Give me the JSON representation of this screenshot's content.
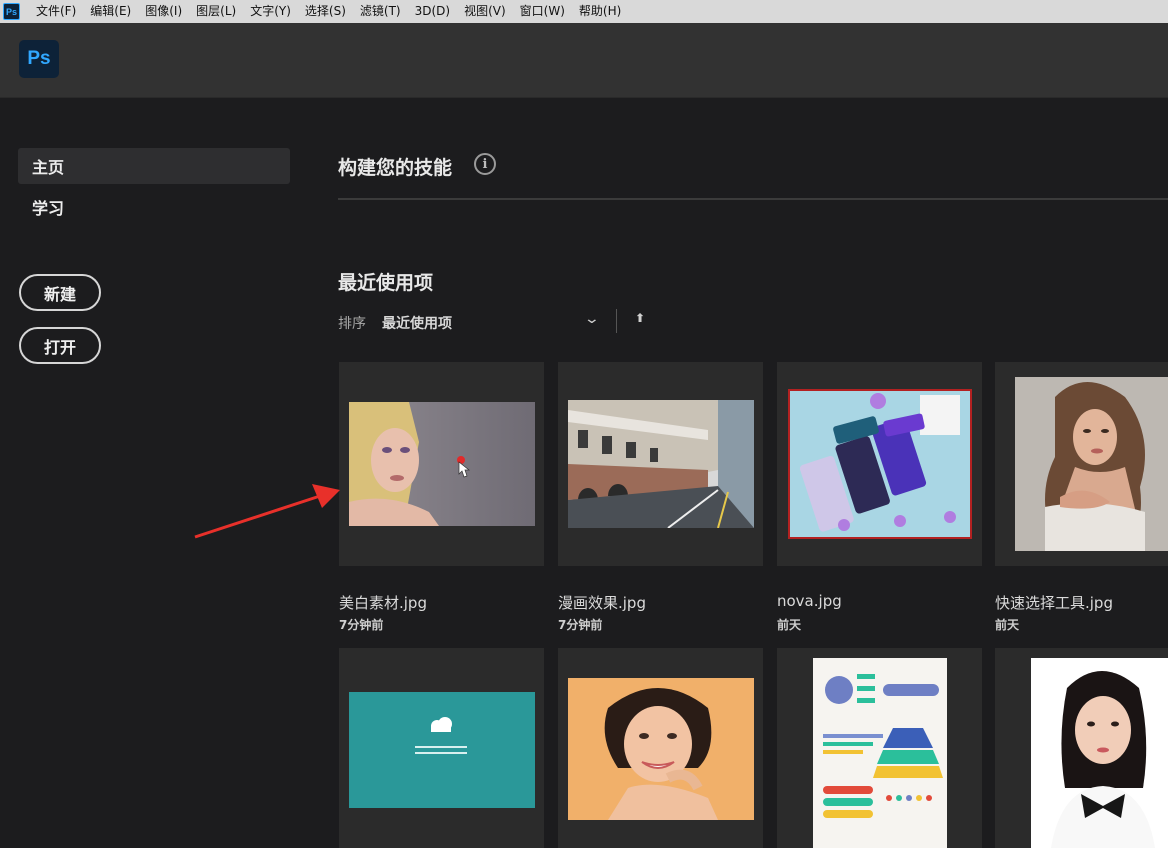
{
  "menubar": {
    "items": [
      "文件(F)",
      "编辑(E)",
      "图像(I)",
      "图层(L)",
      "文字(Y)",
      "选择(S)",
      "滤镜(T)",
      "3D(D)",
      "视图(V)",
      "窗口(W)",
      "帮助(H)"
    ],
    "app_icon": "Ps"
  },
  "header": {
    "logo": "Ps"
  },
  "sidebar": {
    "nav": [
      {
        "label": "主页",
        "active": true
      },
      {
        "label": "学习",
        "active": false
      }
    ],
    "new_button": "新建",
    "open_button": "打开"
  },
  "main": {
    "build_title": "构建您的技能",
    "info_icon": "i",
    "recent_title": "最近使用项",
    "sort_label": "排序",
    "sort_value": "最近使用项",
    "sort_chevron": "⌄",
    "sort_arrow": "⬆"
  },
  "recent_files": [
    {
      "name": "美白素材.jpg",
      "time": "7分钟前"
    },
    {
      "name": "漫画效果.jpg",
      "time": "7分钟前"
    },
    {
      "name": "nova.jpg",
      "time": "前天"
    },
    {
      "name": "快速选择工具.jpg",
      "time": "前天"
    }
  ],
  "colors": {
    "accent": "#31a8ff",
    "background": "#1c1c1e",
    "annotation_arrow": "#e8302a"
  }
}
